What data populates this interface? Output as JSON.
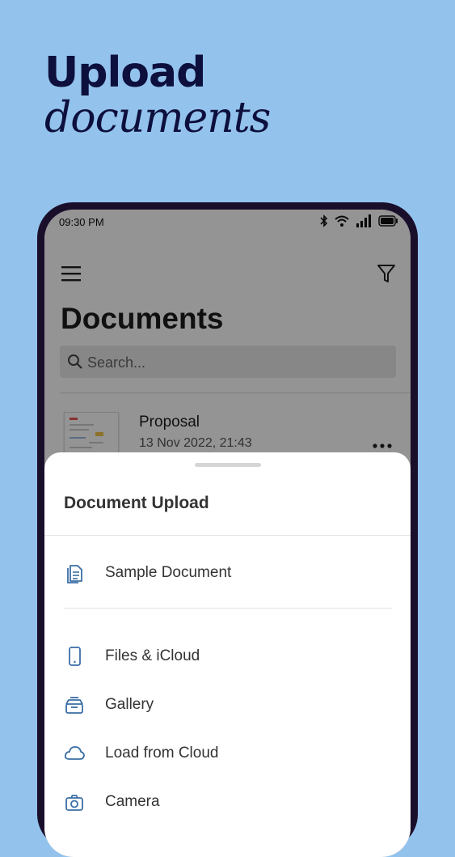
{
  "promo": {
    "line1": "Upload",
    "line2": "documents"
  },
  "status": {
    "time": "09:30 PM"
  },
  "header": {
    "title": "Documents"
  },
  "search": {
    "placeholder": "Search..."
  },
  "documents": [
    {
      "name": "Proposal",
      "date": "13 Nov 2022, 21:43"
    }
  ],
  "sheet": {
    "title": "Document Upload",
    "options": [
      {
        "label": "Sample Document",
        "icon": "document-icon"
      },
      {
        "label": "Files & iCloud",
        "icon": "phone-icon"
      },
      {
        "label": "Gallery",
        "icon": "gallery-icon"
      },
      {
        "label": "Load from Cloud",
        "icon": "cloud-icon"
      },
      {
        "label": "Camera",
        "icon": "camera-icon"
      }
    ]
  },
  "colors": {
    "background": "#93c3ec",
    "accent": "#3a6ea5",
    "promo_text": "#0d0f3d",
    "phone_frame": "#1a0f2b"
  }
}
